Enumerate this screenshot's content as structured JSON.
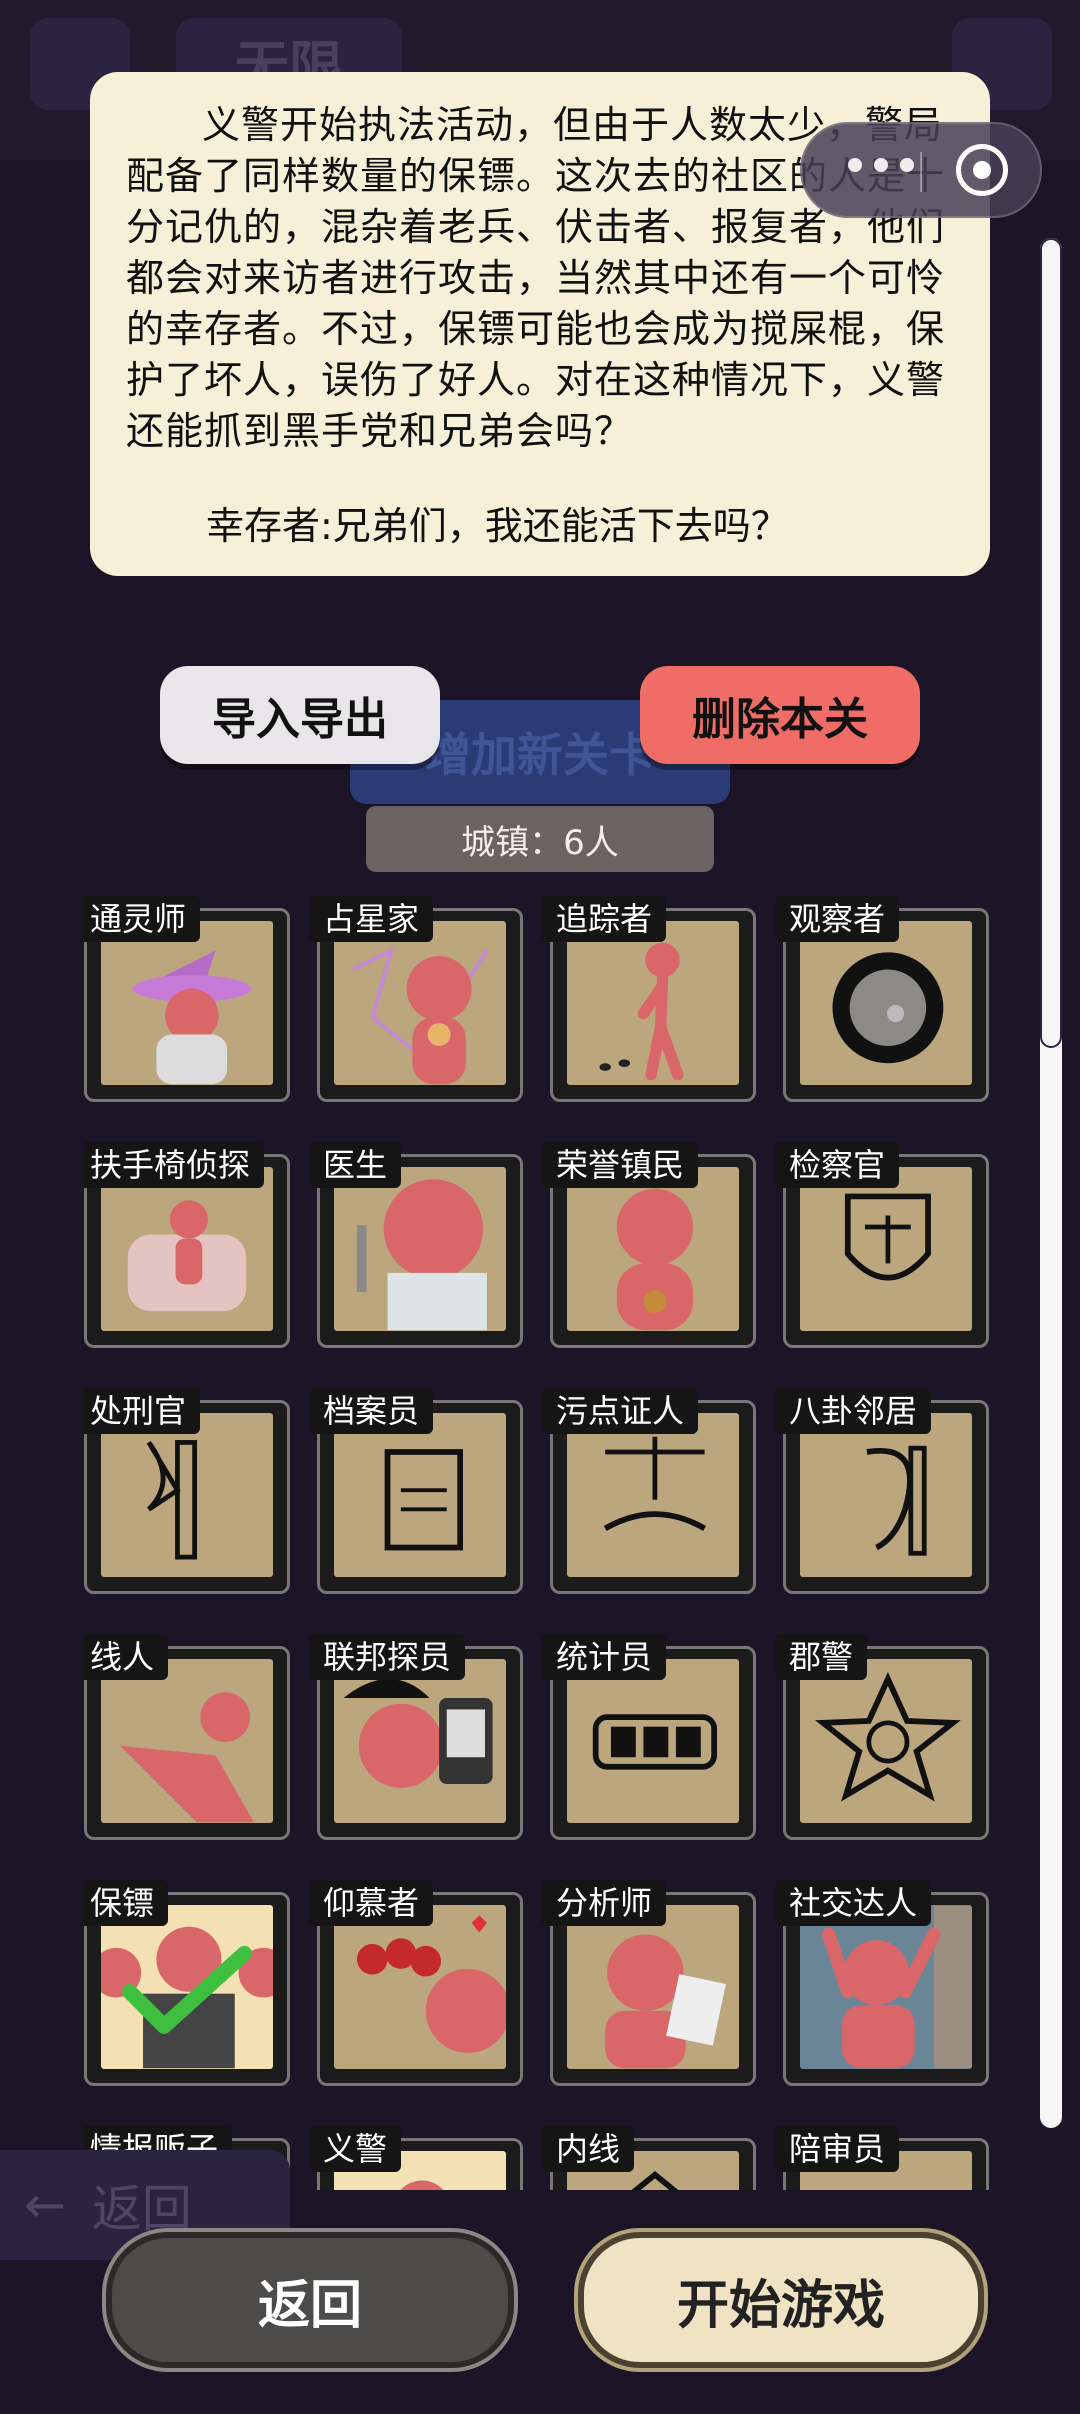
{
  "background_ghost": {
    "top_badge": "无限",
    "bottom_back": "返回"
  },
  "story": {
    "paragraph": "义警开始执法活动，但由于人数太少，警局配备了同样数量的保镖。这次去的社区的人是十分记仇的，混杂着老兵、伏击者、报复者，他们都会对来访者进行攻击，当然其中还有一个可怜的幸存者。不过，保镖可能也会成为搅屎棍，保护了坏人，误伤了好人。对在这种情况下，义警还能抓到黑手党和兄弟会吗？",
    "quote": "幸存者:兄弟们，我还能活下去吗？"
  },
  "actions": {
    "import_export": "导入导出",
    "delete_level": "删除本关",
    "add_level_ghost": "增加新关卡"
  },
  "town_label": "城镇：6人",
  "roles": [
    {
      "name": "通灵师",
      "icon": "witch-hat-icon"
    },
    {
      "name": "占星家",
      "icon": "constellation-icon"
    },
    {
      "name": "追踪者",
      "icon": "footprints-icon"
    },
    {
      "name": "观察者",
      "icon": "eye-icon"
    },
    {
      "name": "扶手椅侦探",
      "icon": "armchair-icon"
    },
    {
      "name": "医生",
      "icon": "syringe-icon"
    },
    {
      "name": "荣誉镇民",
      "icon": "medal-icon"
    },
    {
      "name": "检察官",
      "icon": "justice-shield-icon"
    },
    {
      "name": "处刑官",
      "icon": "axe-icon"
    },
    {
      "name": "档案员",
      "icon": "documents-icon"
    },
    {
      "name": "污点证人",
      "icon": "scales-handshake-icon"
    },
    {
      "name": "八卦邻居",
      "icon": "ear-icon"
    },
    {
      "name": "线人",
      "icon": "pointing-hand-icon"
    },
    {
      "name": "联邦探员",
      "icon": "fbi-badge-icon"
    },
    {
      "name": "统计员",
      "icon": "counter-icon"
    },
    {
      "name": "郡警",
      "icon": "sheriff-star-icon"
    },
    {
      "name": "保镖",
      "icon": "bodyguards-icon",
      "selected": true
    },
    {
      "name": "仰慕者",
      "icon": "roses-icon"
    },
    {
      "name": "分析师",
      "icon": "paper-icon"
    },
    {
      "name": "社交达人",
      "icon": "door-wave-icon"
    },
    {
      "name": "情报贩子",
      "icon": "info-icon"
    },
    {
      "name": "义警",
      "icon": "vigilante-icon"
    },
    {
      "name": "内线",
      "icon": "house-icon"
    },
    {
      "name": "陪审员",
      "icon": "juror-icon"
    }
  ],
  "bottom": {
    "back": "返回",
    "start": "开始游戏"
  },
  "colors": {
    "background": "#1c1527",
    "card_art": "#bba67e",
    "figure": "#d9676a",
    "delete_button": "#f06c66",
    "selected_check": "#3fbf3f"
  }
}
